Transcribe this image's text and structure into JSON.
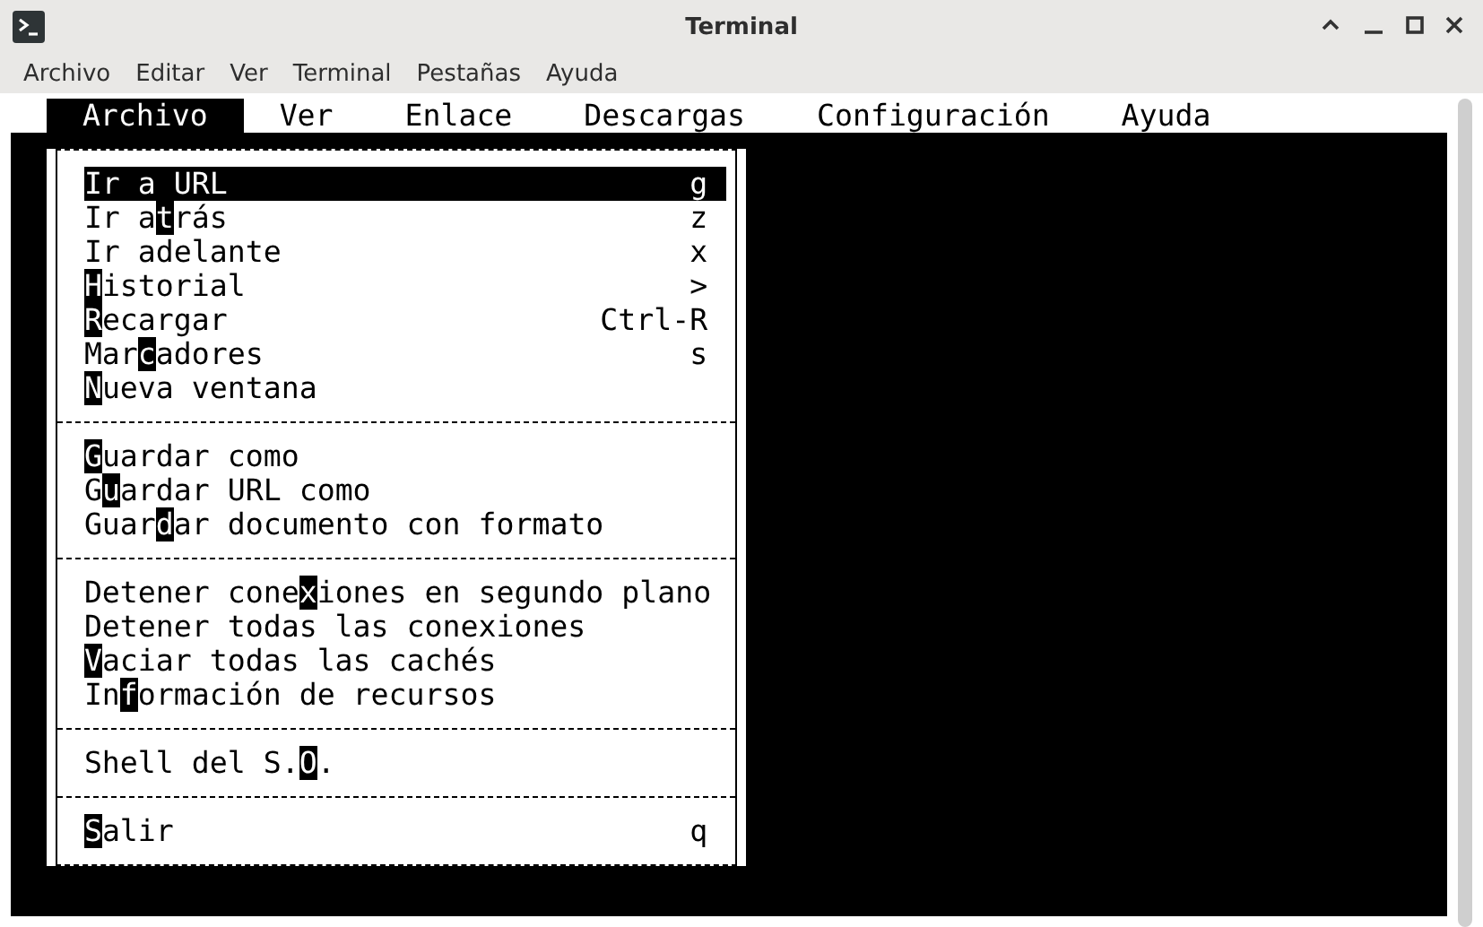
{
  "window": {
    "title": "Terminal"
  },
  "menu_bar": [
    {
      "label": "Archivo"
    },
    {
      "label": "Editar"
    },
    {
      "label": "Ver"
    },
    {
      "label": "Terminal"
    },
    {
      "label": "Pestañas"
    },
    {
      "label": "Ayuda"
    }
  ],
  "terminal": {
    "menu_bar": [
      {
        "label": "Archivo",
        "selected": true
      },
      {
        "label": "Ver",
        "selected": false
      },
      {
        "label": "Enlace",
        "selected": false
      },
      {
        "label": "Descargas",
        "selected": false
      },
      {
        "label": "Configuración",
        "selected": false
      },
      {
        "label": "Ayuda",
        "selected": false
      }
    ],
    "menu": {
      "sections": [
        {
          "items": [
            {
              "label": "Ir a URL",
              "shortcut": "g",
              "selected": true
            },
            {
              "label": "Ir a**t**rás",
              "shortcut": "z",
              "selected": false
            },
            {
              "label": "Ir adelante",
              "shortcut": "x",
              "selected": false
            },
            {
              "label": "**H**istorial",
              "shortcut": ">",
              "selected": false
            },
            {
              "label": "**R**ecargar",
              "shortcut": "Ctrl-R",
              "selected": false
            },
            {
              "label": "Mar**c**adores",
              "shortcut": "s",
              "selected": false
            },
            {
              "label": "**N**ueva ventana",
              "selected": false
            }
          ]
        },
        {
          "items": [
            {
              "label": "**G**uardar como",
              "selected": false
            },
            {
              "label": "G**u**ardar URL como",
              "selected": false
            },
            {
              "label": "Guar**d**ar documento con formato",
              "selected": false
            }
          ]
        },
        {
          "items": [
            {
              "label": "Detener cone**x**iones en segundo plano",
              "selected": false
            },
            {
              "label": "Detener todas las conexiones",
              "selected": false
            },
            {
              "label": "**V**aciar todas las cachés",
              "selected": false
            },
            {
              "label": "In**f**ormación de recursos",
              "selected": false
            }
          ]
        },
        {
          "items": [
            {
              "label": "Shell del S.**O**.",
              "selected": false
            }
          ]
        },
        {
          "items": [
            {
              "label": "**S**alir",
              "shortcut": "q",
              "selected": false
            }
          ]
        }
      ]
    }
  }
}
